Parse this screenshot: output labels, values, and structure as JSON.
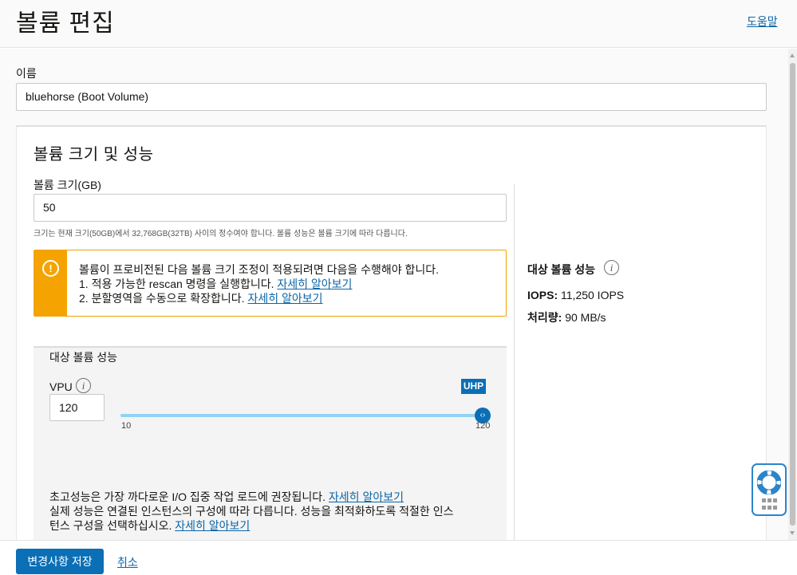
{
  "header": {
    "title": "볼륨 편집",
    "help_link": "도움말"
  },
  "form": {
    "name_label": "이름",
    "name_value": "bluehorse (Boot Volume)"
  },
  "panel": {
    "title": "볼륨 크기 및 성능",
    "size_label": "볼륨 크기(GB)",
    "size_value": "50",
    "size_hint": "크기는 현재 크기(50GB)에서 32,768GB(32TB) 사이의 정수여야 합니다. 볼륨 성능은 볼륨 크기에 따라 다릅니다.",
    "warning": {
      "line1": "볼륨이 프로비전된 다음 볼륨 크기 조정이 적용되려면 다음을 수행해야 합니다.",
      "line2_text": "1. 적용 가능한 rescan 명령을 실행합니다. ",
      "line2_link": "자세히 알아보기",
      "line3_text": "2. 분할영역을 수동으로 확장합니다. ",
      "line3_link": "자세히 알아보기"
    },
    "performance": {
      "title": "대상 볼륨 성능",
      "vpu_label": "VPU",
      "vpu_value": "120",
      "badge": "UHP",
      "slider_min": "10",
      "slider_max": "120",
      "slider_value": 120,
      "note1_text": "초고성능은 가장 까다로운 I/O 집중 작업 로드에 권장됩니다. ",
      "note1_link": "자세히 알아보기",
      "note2_text": "실제 성능은 연결된 인스턴스의 구성에 따라 다릅니다. 성능을 최적화하도록 적절한 인스",
      "note3_text": "턴스 구성을 선택하십시오. ",
      "note3_link": "자세히 알아보기"
    },
    "target": {
      "title": "대상 볼륨 성능",
      "iops_label": "IOPS:",
      "iops_value": " 11,250 IOPS",
      "throughput_label": "처리량:",
      "throughput_value": " 90 MB/s"
    }
  },
  "footer": {
    "save_label": "변경사항 저장",
    "cancel_label": "취소"
  },
  "colors": {
    "accent": "#0b6fb5",
    "link": "#0b65a8",
    "warning": "#f5a300",
    "slider_track": "#8fd3f2"
  },
  "icons": {
    "warning": "exclamation-icon",
    "info": "info-icon",
    "slider_thumb": "slider-thumb-icon",
    "help_widget": "lifebuoy-icon"
  }
}
